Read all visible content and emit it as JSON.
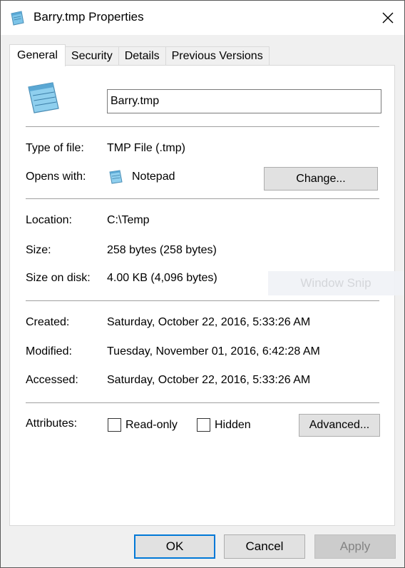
{
  "window": {
    "title": "Barry.tmp Properties",
    "close_icon": "close-icon",
    "app_icon": "notepad-file-icon"
  },
  "tabs": [
    {
      "label": "General",
      "active": true
    },
    {
      "label": "Security",
      "active": false
    },
    {
      "label": "Details",
      "active": false
    },
    {
      "label": "Previous Versions",
      "active": false
    }
  ],
  "general": {
    "file_name": "Barry.tmp",
    "type_label": "Type of file:",
    "type_value": "TMP File (.tmp)",
    "opens_label": "Opens with:",
    "opens_value": "Notepad",
    "change_label": "Change...",
    "location_label": "Location:",
    "location_value": "C:\\Temp",
    "size_label": "Size:",
    "size_value": "258 bytes (258 bytes)",
    "size_disk_label": "Size on disk:",
    "size_disk_value": "4.00 KB (4,096 bytes)",
    "created_label": "Created:",
    "created_value": "Saturday, October 22, 2016, 5:33:26 AM",
    "modified_label": "Modified:",
    "modified_value": "Tuesday, November 01, 2016, 6:42:28 AM",
    "accessed_label": "Accessed:",
    "accessed_value": "Saturday, October 22, 2016, 5:33:26 AM",
    "attributes_label": "Attributes:",
    "readonly_label": "Read-only",
    "readonly_checked": false,
    "hidden_label": "Hidden",
    "hidden_checked": false,
    "advanced_label": "Advanced..."
  },
  "overlay": {
    "watermark": "Window Snip"
  },
  "footer": {
    "ok": "OK",
    "cancel": "Cancel",
    "apply": "Apply"
  },
  "colors": {
    "accent": "#0078d7",
    "window_bg": "#f0f0f0",
    "panel_bg": "#ffffff"
  }
}
